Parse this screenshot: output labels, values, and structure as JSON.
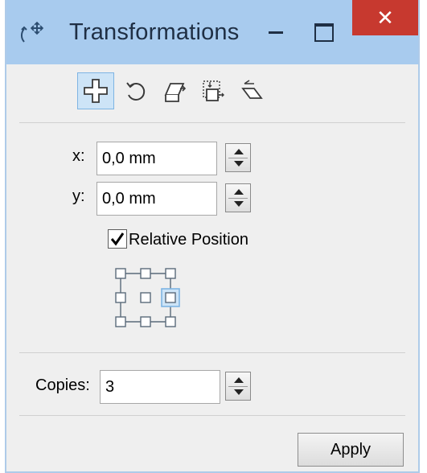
{
  "window": {
    "title": "Transformations",
    "close_glyph": "✕"
  },
  "toolbar": {
    "tools": [
      {
        "name": "position",
        "icon": "move-cross-icon",
        "active": true
      },
      {
        "name": "rotate",
        "icon": "rotate-icon",
        "active": false
      },
      {
        "name": "scale-mirror",
        "icon": "scale-mirror-icon",
        "active": false
      },
      {
        "name": "size",
        "icon": "size-icon",
        "active": false
      },
      {
        "name": "skew",
        "icon": "skew-icon",
        "active": false
      }
    ]
  },
  "position": {
    "x_label": "x:",
    "x_value": "0,0 mm",
    "y_label": "y:",
    "y_value": "0,0 mm",
    "relative_label": "Relative Position",
    "relative_checked": true,
    "anchor_selected": "middle-right"
  },
  "copies": {
    "label": "Copies:",
    "value": "3"
  },
  "apply_label": "Apply",
  "colors": {
    "titlebar": "#a8cbee",
    "close": "#c7392f",
    "panel": "#efefef",
    "accent": "#7eb4e3"
  }
}
